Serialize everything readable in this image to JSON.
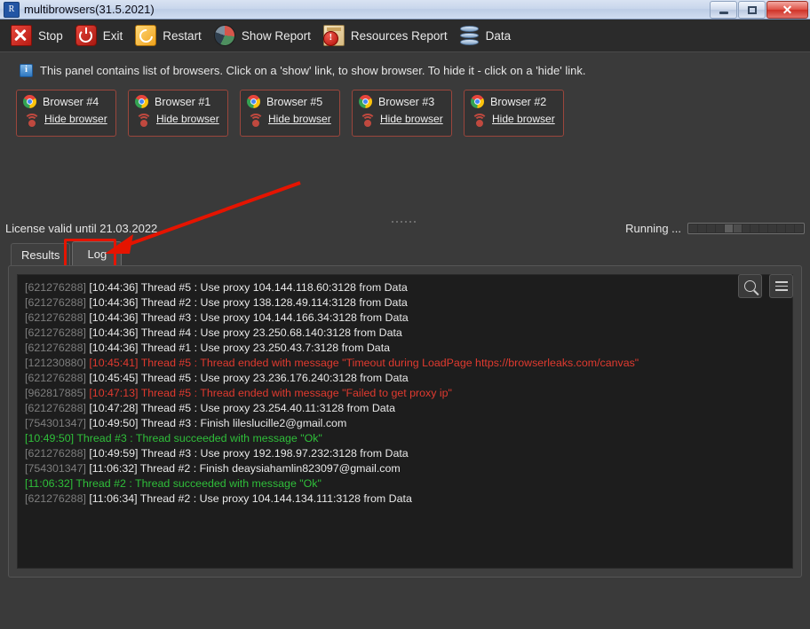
{
  "window": {
    "title": "multibrowsers(31.5.2021)",
    "ghost_text": "",
    "app_icon": "app-icon",
    "minimize_label": "",
    "maximize_label": "",
    "close_label": "✕"
  },
  "toolbar": {
    "items": [
      {
        "label": "Stop",
        "icon": "stop-icon"
      },
      {
        "label": "Exit",
        "icon": "power-icon"
      },
      {
        "label": "Restart",
        "icon": "refresh-icon"
      },
      {
        "label": "Show Report",
        "icon": "pie-chart-icon"
      },
      {
        "label": "Resources Report",
        "icon": "warning-document-icon"
      },
      {
        "label": "Data",
        "icon": "database-icon"
      }
    ]
  },
  "info": {
    "icon": "info-icon",
    "badge": "i",
    "text": "This panel contains list of browsers. Click on a 'show' link, to show browser. To hide it - click on a 'hide' link."
  },
  "browsers": [
    {
      "name": "Browser #4",
      "action": "Hide browser",
      "icon": "chrome-icon",
      "status_icon": "wifi-icon"
    },
    {
      "name": "Browser #1",
      "action": "Hide browser",
      "icon": "chrome-icon",
      "status_icon": "wifi-icon"
    },
    {
      "name": "Browser #5",
      "action": "Hide browser",
      "icon": "chrome-icon",
      "status_icon": "wifi-icon"
    },
    {
      "name": "Browser #3",
      "action": "Hide browser",
      "icon": "chrome-icon",
      "status_icon": "wifi-icon"
    },
    {
      "name": "Browser #2",
      "action": "Hide browser",
      "icon": "chrome-icon",
      "status_icon": "wifi-icon"
    }
  ],
  "status": {
    "license": "License valid until 21.03.2022",
    "running_label": "Running ...",
    "progress_segments": 13,
    "progress_active_index": 4
  },
  "tabs": [
    {
      "label": "Results",
      "active": false
    },
    {
      "label": "Log",
      "active": true
    }
  ],
  "log": {
    "search_icon": "search-icon",
    "menu_icon": "hamburger-menu-icon",
    "lines": [
      {
        "tid": "[621276288] ",
        "text": "[10:44:36] Thread #5 : Use proxy 104.144.118.60:3128 from Data",
        "level": "info"
      },
      {
        "tid": "[621276288] ",
        "text": "[10:44:36] Thread #2 : Use proxy 138.128.49.114:3128 from Data",
        "level": "info"
      },
      {
        "tid": "[621276288] ",
        "text": "[10:44:36] Thread #3 : Use proxy 104.144.166.34:3128 from Data",
        "level": "info"
      },
      {
        "tid": "[621276288] ",
        "text": "[10:44:36] Thread #4 : Use proxy 23.250.68.140:3128 from Data",
        "level": "info"
      },
      {
        "tid": "[621276288] ",
        "text": "[10:44:36] Thread #1 : Use proxy 23.250.43.7:3128 from Data",
        "level": "info"
      },
      {
        "tid": "[121230880] ",
        "text": "[10:45:41] Thread #5 : Thread ended with message \"Timeout during LoadPage https://browserleaks.com/canvas\"",
        "level": "error"
      },
      {
        "tid": "[621276288] ",
        "text": "[10:45:45] Thread #5 : Use proxy 23.236.176.240:3128 from Data",
        "level": "info"
      },
      {
        "tid": "[962817885] ",
        "text": "[10:47:13] Thread #5 : Thread ended with message \"Failed to get proxy ip\"",
        "level": "error"
      },
      {
        "tid": "[621276288] ",
        "text": "[10:47:28] Thread #5 : Use proxy 23.254.40.11:3128 from Data",
        "level": "info"
      },
      {
        "tid": "[754301347] ",
        "text": "[10:49:50] Thread #3 : Finish lileslucille2@gmail.com",
        "level": "info"
      },
      {
        "tid": "",
        "text": "[10:49:50] Thread #3 : Thread succeeded with message \"Ok\"",
        "level": "success"
      },
      {
        "tid": "[621276288] ",
        "text": "[10:49:59] Thread #3 : Use proxy 192.198.97.232:3128 from Data",
        "level": "info"
      },
      {
        "tid": "[754301347] ",
        "text": "[11:06:32] Thread #2 : Finish deaysiahamlin823097@gmail.com",
        "level": "info"
      },
      {
        "tid": "",
        "text": "[11:06:32] Thread #2 : Thread succeeded with message \"Ok\"",
        "level": "success"
      },
      {
        "tid": "[621276288] ",
        "text": "[11:06:34] Thread #2 : Use proxy 104.144.134.111:3128 from Data",
        "level": "info"
      }
    ]
  },
  "annotation": {
    "highlight_color": "#e51400",
    "arrow_color": "#e51400",
    "target": "Log"
  },
  "colors": {
    "error": "#e03a2f",
    "success": "#2fbf3a",
    "thread_id": "#7e7e7e",
    "card_border": "#9b463c",
    "background": "#3a3a3a"
  }
}
